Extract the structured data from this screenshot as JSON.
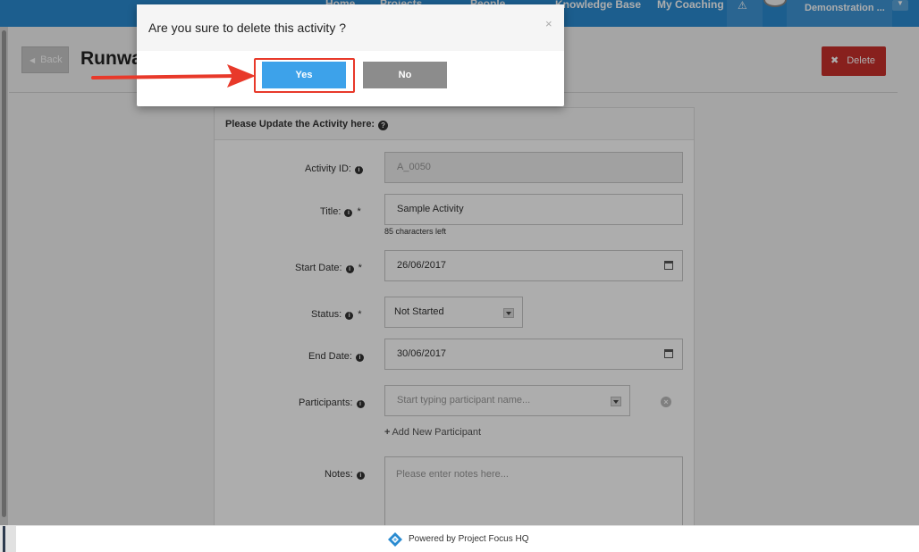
{
  "topnav": {
    "items": [
      "Home",
      "Projects",
      "People",
      "Knowledge Base",
      "My Coaching"
    ],
    "alert_icon": "⚠",
    "user_label": "Demonstration ...",
    "caret": "▼"
  },
  "page": {
    "back_label": "Back",
    "title": "Runwa",
    "delete_label": "Delete"
  },
  "form": {
    "heading": "Please Update the Activity here:",
    "activity_id": {
      "label": "Activity ID:",
      "value": "A_0050"
    },
    "title": {
      "label": "Title:",
      "value": "Sample Activity",
      "hint": "85 characters left"
    },
    "start_date": {
      "label": "Start Date:",
      "value": "26/06/2017"
    },
    "status": {
      "label": "Status:",
      "value": "Not Started"
    },
    "end_date": {
      "label": "End Date:",
      "value": "30/06/2017"
    },
    "participants": {
      "label": "Participants:",
      "placeholder": "Start typing participant name...",
      "add_label": "Add New Participant"
    },
    "notes": {
      "label": "Notes:",
      "placeholder": "Please enter notes here..."
    }
  },
  "footer": {
    "text": "Powered by Project Focus HQ"
  },
  "modal": {
    "title": "Are you sure to delete this activity ?",
    "close": "×",
    "yes_label": "Yes",
    "no_label": "No"
  },
  "colors": {
    "nav_blue": "#2a8bd1",
    "yes_blue": "#3da2ea",
    "no_gray": "#8c8c8c",
    "delete_red": "#c9302c",
    "highlight_red": "#e8392a"
  }
}
